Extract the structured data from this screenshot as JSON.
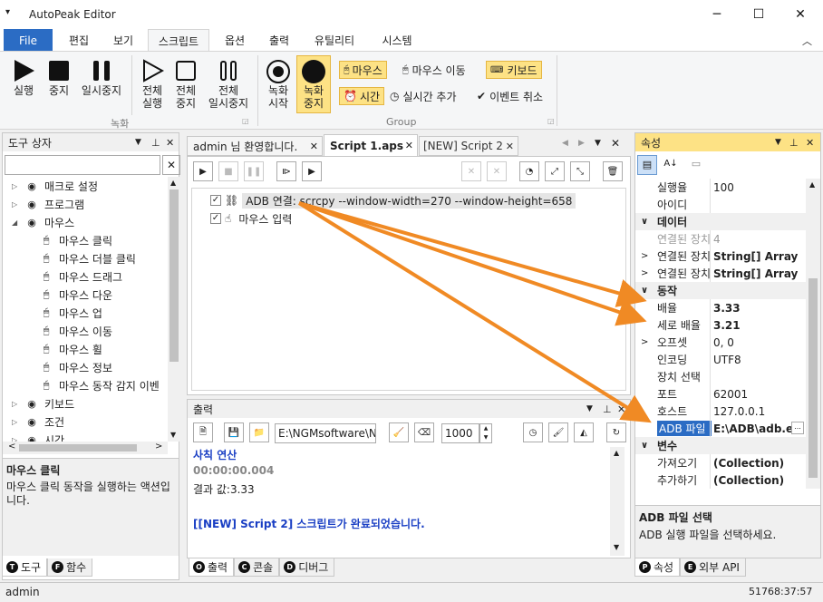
{
  "window": {
    "title": "AutoPeak Editor",
    "min": "─",
    "max": "☐",
    "close": "✕"
  },
  "ribbon_tabs": [
    {
      "label": "File"
    },
    {
      "label": "편집"
    },
    {
      "label": "보기"
    },
    {
      "label": "스크립트"
    },
    {
      "label": "옵션"
    },
    {
      "label": "출력"
    },
    {
      "label": "유틸리티"
    },
    {
      "label": "시스템"
    }
  ],
  "ribbon": {
    "run": "실행",
    "stop": "중지",
    "pause": "일시중지",
    "run_all": "전체\n실행",
    "stop_all": "전체\n중지",
    "pause_all": "전체\n일시중지",
    "group_record": "녹화",
    "rec_start": "녹화\n시작",
    "rec_stop": "녹화\n중지",
    "mouse": "마우스",
    "mouse_move": "마우스 이동",
    "keyboard": "키보드",
    "time": "시간",
    "realtime_add": "실시간 추가",
    "event_cancel": "이벤트 취소",
    "group_group": "Group"
  },
  "toolbox": {
    "title": "도구 상자",
    "search_value": "",
    "items": [
      {
        "label": "매크로 설정",
        "indent": 1,
        "exp": "▷"
      },
      {
        "label": "프로그램",
        "indent": 1,
        "exp": "▷"
      },
      {
        "label": "마우스",
        "indent": 1,
        "exp": "◢"
      },
      {
        "label": "마우스 클릭",
        "indent": 2,
        "exp": ""
      },
      {
        "label": "마우스 더블 클릭",
        "indent": 2,
        "exp": ""
      },
      {
        "label": "마우스 드래그",
        "indent": 2,
        "exp": ""
      },
      {
        "label": "마우스 다운",
        "indent": 2,
        "exp": ""
      },
      {
        "label": "마우스 업",
        "indent": 2,
        "exp": ""
      },
      {
        "label": "마우스 이동",
        "indent": 2,
        "exp": ""
      },
      {
        "label": "마우스 휠",
        "indent": 2,
        "exp": ""
      },
      {
        "label": "마우스 정보",
        "indent": 2,
        "exp": ""
      },
      {
        "label": "마우스 동작 감지 이벤",
        "indent": 2,
        "exp": ""
      },
      {
        "label": "키보드",
        "indent": 1,
        "exp": "▷"
      },
      {
        "label": "조건",
        "indent": 1,
        "exp": "▷"
      },
      {
        "label": "시간",
        "indent": 1,
        "exp": "▷"
      }
    ],
    "desc_title": "마우스 클릭",
    "desc_text": "마우스 클릭 동작을 실행하는 액션입니다.",
    "tabs": [
      {
        "icon": "T",
        "label": "도구"
      },
      {
        "icon": "F",
        "label": "함수"
      }
    ]
  },
  "editor": {
    "tabs": [
      {
        "label": "admin 님 환영합니다."
      },
      {
        "label": "Script 1.aps"
      },
      {
        "label": "[NEW] Script 2"
      }
    ],
    "lines": [
      {
        "label": "ADB 연결: scrcpy --window-width=270 --window-height=658"
      },
      {
        "label": "마우스 입력"
      }
    ]
  },
  "output": {
    "title": "출력",
    "path_value": "E:\\NGMsoftware\\NG",
    "count_value": "1000",
    "lines": [
      {
        "text": "사칙 연산",
        "color": "#1a3fc4",
        "bold": true
      },
      {
        "text": "00:00:00.004",
        "color": "#888888",
        "bold": true
      },
      {
        "text": "결과 값:3.33",
        "color": "#222222",
        "bold": false
      },
      {
        "text": "",
        "color": "#222222",
        "bold": false
      },
      {
        "text": "[[NEW] Script 2] 스크립트가 완료되었습니다.",
        "color": "#1a3fc4",
        "bold": true
      }
    ],
    "tabs": [
      {
        "icon": "O",
        "label": "출력"
      },
      {
        "icon": "C",
        "label": "콘솔"
      },
      {
        "icon": "D",
        "label": "디버그"
      }
    ]
  },
  "properties": {
    "title": "속성",
    "rows": [
      {
        "k": "실행율",
        "v": "100",
        "cat": false,
        "exp": "",
        "bold": false
      },
      {
        "k": "아이디",
        "v": "",
        "cat": false,
        "exp": "",
        "bold": false
      },
      {
        "k": "데이터",
        "v": "",
        "cat": true,
        "exp": "∨",
        "bold": false
      },
      {
        "k": "연결된 장치",
        "v": "4",
        "cat": false,
        "exp": "",
        "bold": false,
        "dim": true
      },
      {
        "k": "연결된 장치",
        "v": "String[] Array",
        "cat": false,
        "exp": ">",
        "bold": true
      },
      {
        "k": "연결된 장치",
        "v": "String[] Array",
        "cat": false,
        "exp": ">",
        "bold": true
      },
      {
        "k": "동작",
        "v": "",
        "cat": true,
        "exp": "∨",
        "bold": false
      },
      {
        "k": "배율",
        "v": "3.33",
        "cat": false,
        "exp": "",
        "bold": true
      },
      {
        "k": "세로 배율",
        "v": "3.21",
        "cat": false,
        "exp": "",
        "bold": true
      },
      {
        "k": "오프셋",
        "v": "0, 0",
        "cat": false,
        "exp": ">",
        "bold": false
      },
      {
        "k": "인코딩",
        "v": "UTF8",
        "cat": false,
        "exp": "",
        "bold": false
      },
      {
        "k": "장치 선택",
        "v": "",
        "cat": false,
        "exp": "",
        "bold": false
      },
      {
        "k": "포트",
        "v": "62001",
        "cat": false,
        "exp": "",
        "bold": false
      },
      {
        "k": "호스트",
        "v": "127.0.0.1",
        "cat": false,
        "exp": "",
        "bold": false
      },
      {
        "k": "ADB 파일",
        "v": "E:\\ADB\\adb.e",
        "cat": false,
        "exp": "",
        "bold": true,
        "sel": true
      },
      {
        "k": "변수",
        "v": "",
        "cat": true,
        "exp": "∨",
        "bold": false
      },
      {
        "k": "가져오기",
        "v": "(Collection)",
        "cat": false,
        "exp": "",
        "bold": true
      },
      {
        "k": "추가하기",
        "v": "(Collection)",
        "cat": false,
        "exp": "",
        "bold": true
      }
    ],
    "desc_title": "ADB 파일 선택",
    "desc_text": "ADB 실행 파일을 선택하세요.",
    "tabs": [
      {
        "icon": "P",
        "label": "속성"
      },
      {
        "icon": "E",
        "label": "외부 API"
      }
    ]
  },
  "status": {
    "left": "admin",
    "right": "51768:37:57"
  }
}
